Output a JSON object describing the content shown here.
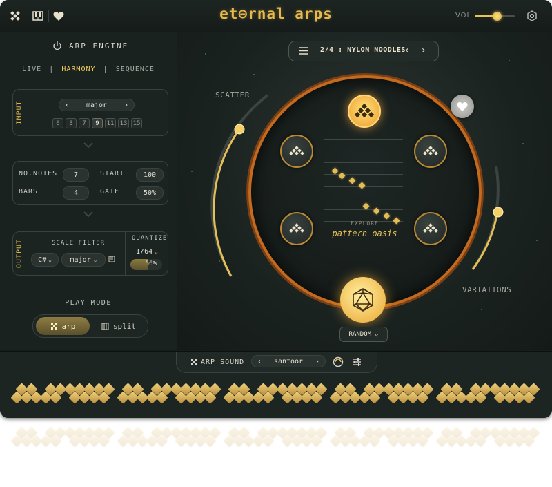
{
  "app": {
    "title": "et⊖rnal arps",
    "vol_label": "VOL",
    "volume": 0.55
  },
  "left": {
    "engine_title": "ARP ENGINE",
    "modes": [
      "LIVE",
      "HARMONY",
      "SEQUENCE"
    ],
    "mode_separator": "|",
    "active_mode": "HARMONY",
    "input": {
      "tab_label": "INPUT",
      "scale": "major",
      "notes": [
        {
          "label": "0",
          "on": false
        },
        {
          "label": "3",
          "on": false
        },
        {
          "label": "7",
          "on": false
        },
        {
          "label": "9",
          "on": true
        },
        {
          "label": "11",
          "on": false
        },
        {
          "label": "13",
          "on": false
        },
        {
          "label": "15",
          "on": false
        }
      ]
    },
    "params": {
      "no_notes_label": "NO.NOTES",
      "no_notes": "7",
      "start_label": "START",
      "start": "100",
      "bars_label": "BARS",
      "bars": "4",
      "gate_label": "GATE",
      "gate": "50%"
    },
    "output": {
      "tab_label": "OUTPUT",
      "scale_filter_label": "SCALE FILTER",
      "key": "C#",
      "scale": "major",
      "quantize_label": "QUANTIZE",
      "quantize": "1/64",
      "amount": "56%",
      "amount_value": 0.56
    },
    "play_mode": {
      "label": "PLAY MODE",
      "arp": "arp",
      "split": "split",
      "active": "arp"
    }
  },
  "center": {
    "preset": "2/4 : NYLON NOODLES",
    "scatter_label": "SCATTER",
    "variations_label": "VARIATIONS",
    "explore_label": "EXPLORE",
    "pattern_name": "pattern oasis",
    "random_label": "RANDOM",
    "scatter_value": 0.72,
    "variations_value": 0.55
  },
  "bottom": {
    "arp_sound_label": "ARP SOUND",
    "sound": "santoor"
  },
  "colors": {
    "accent": "#e7b94b",
    "ring": "#c46a1e",
    "bg": "#161d1b"
  }
}
